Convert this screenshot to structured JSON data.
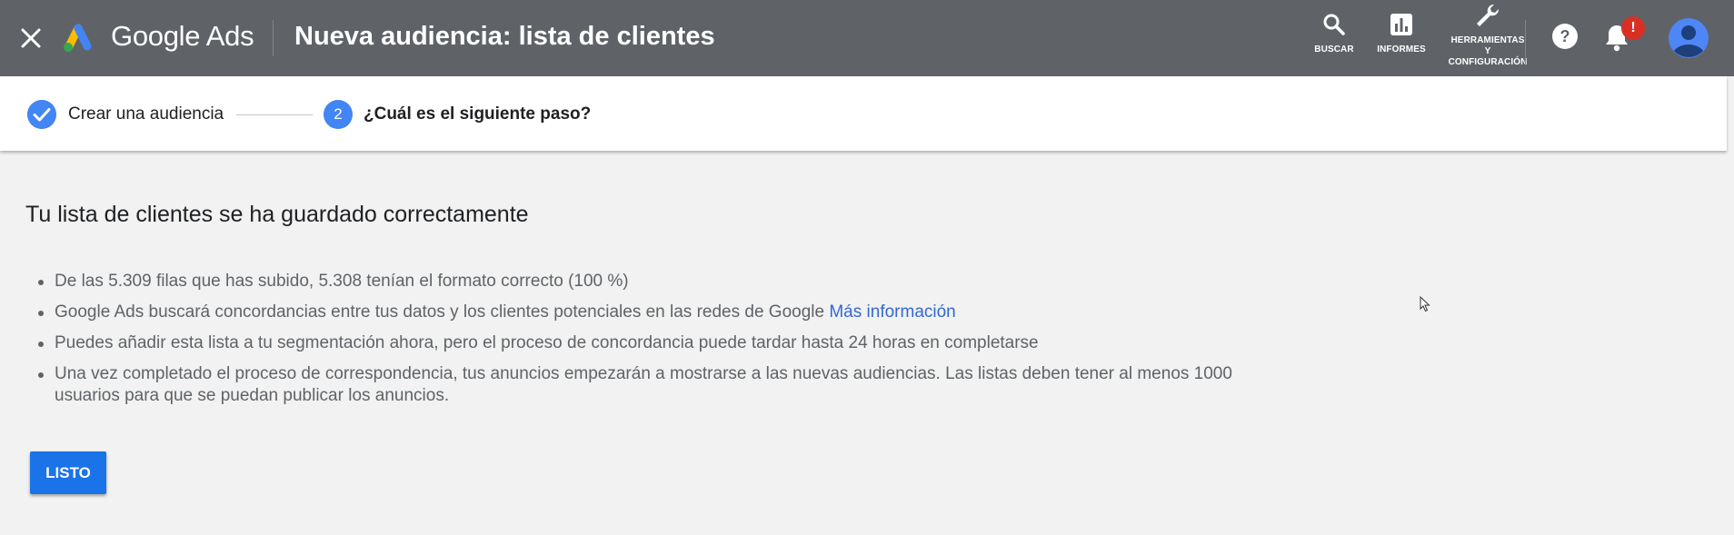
{
  "header": {
    "brand": "Google Ads",
    "title": "Nueva audiencia: lista de clientes",
    "tools": {
      "search": "BUSCAR",
      "reports": "INFORMES",
      "tools_config": "HERRAMIENTAS Y CONFIGURACIÓN"
    },
    "notification_badge": "!",
    "colors": {
      "bar": "#5f6368",
      "badge": "#d93025",
      "accent": "#4285f4"
    }
  },
  "stepper": {
    "step1_label": "Crear una audiencia",
    "step2_number": "2",
    "step2_label": "¿Cuál es el siguiente paso?"
  },
  "main": {
    "heading": "Tu lista de clientes se ha guardado correctamente",
    "bullets": [
      "De las 5.309 filas que has subido, 5.308 tenían el formato correcto (100 %)",
      "Google Ads buscará concordancias entre tus datos y los clientes potenciales en las redes de Google",
      "Puedes añadir esta lista a tu segmentación ahora, pero el proceso de concordancia puede tardar hasta 24 horas en completarse",
      "Una vez completado el proceso de correspondencia, tus anuncios empezarán a mostrarse a las nuevas audiencias. Las listas deben tener al menos 1000 usuarios para que se puedan publicar los anuncios."
    ],
    "more_info_link": "Más información",
    "done_button": "LISTO"
  },
  "icons": [
    "close-icon",
    "google-ads-logo",
    "search-icon",
    "reports-icon",
    "wrench-icon",
    "help-icon",
    "bell-icon",
    "avatar-icon",
    "check-icon",
    "mouse-cursor-icon"
  ]
}
